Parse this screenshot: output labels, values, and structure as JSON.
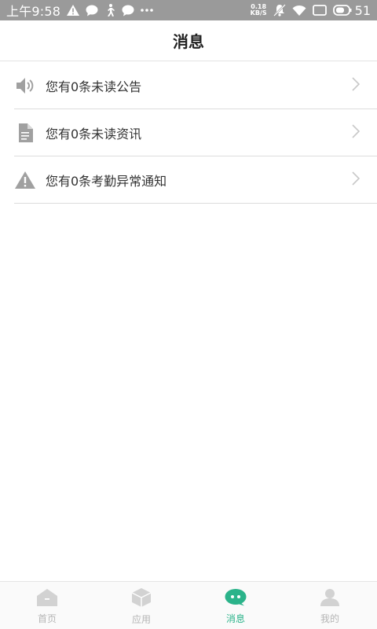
{
  "status_bar": {
    "time": "上午9:58",
    "net_speed_value": "0.18",
    "net_speed_unit": "KB/S",
    "battery_level": "51",
    "icons": [
      "warning-icon",
      "chat-icon",
      "walking-icon",
      "chat-icon",
      "more-dots-icon",
      "mute-icon",
      "wifi-icon",
      "screen-icon",
      "battery-icon"
    ]
  },
  "header": {
    "title": "消息"
  },
  "messages": [
    {
      "icon": "speaker-icon",
      "label": "您有0条未读公告"
    },
    {
      "icon": "document-icon",
      "label": "您有0条未读资讯"
    },
    {
      "icon": "warning-icon",
      "label": "您有0条考勤异常通知"
    }
  ],
  "bottom_nav": {
    "items": [
      {
        "icon": "home-icon",
        "label": "首页",
        "active": false
      },
      {
        "icon": "cube-icon",
        "label": "应用",
        "active": false
      },
      {
        "icon": "chat-bubble-icon",
        "label": "消息",
        "active": true
      },
      {
        "icon": "person-icon",
        "label": "我的",
        "active": false
      }
    ]
  },
  "colors": {
    "status_bar_bg": "#9a9a9a",
    "accent": "#2bb38a",
    "inactive": "#c4c4c4",
    "list_icon": "#9e9e9e"
  }
}
